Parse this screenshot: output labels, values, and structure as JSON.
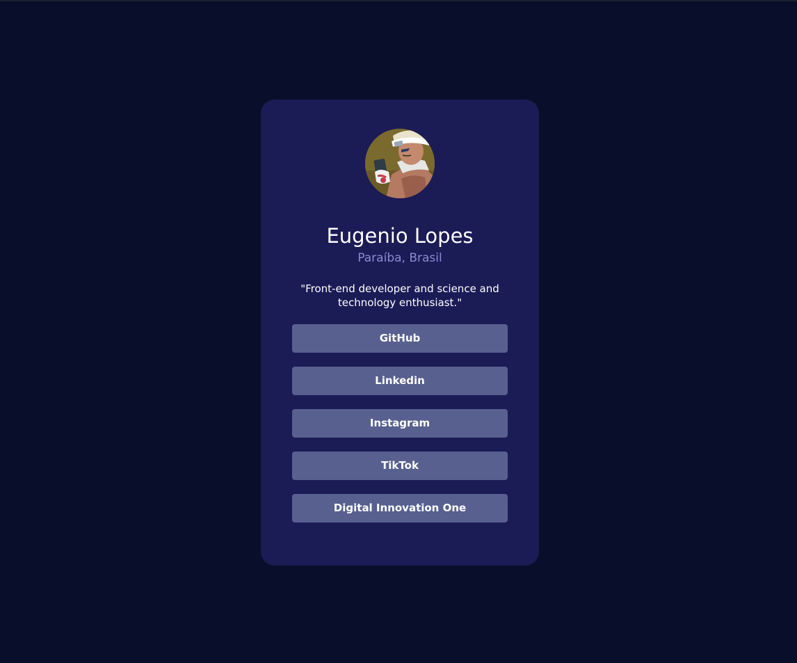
{
  "profile": {
    "name": "Eugenio Lopes",
    "location": "Paraíba, Brasil",
    "bio": "\"Front-end developer and science and technology enthusiast.\""
  },
  "links": [
    {
      "label": "GitHub"
    },
    {
      "label": "Linkedin"
    },
    {
      "label": "Instagram"
    },
    {
      "label": "TikTok"
    },
    {
      "label": "Digital Innovation One"
    }
  ],
  "colors": {
    "page_background": "#090f2a",
    "card_background": "#1b1b56",
    "button_background": "#57608f",
    "location_text": "#8c8ad1",
    "primary_text": "#ffffff"
  }
}
